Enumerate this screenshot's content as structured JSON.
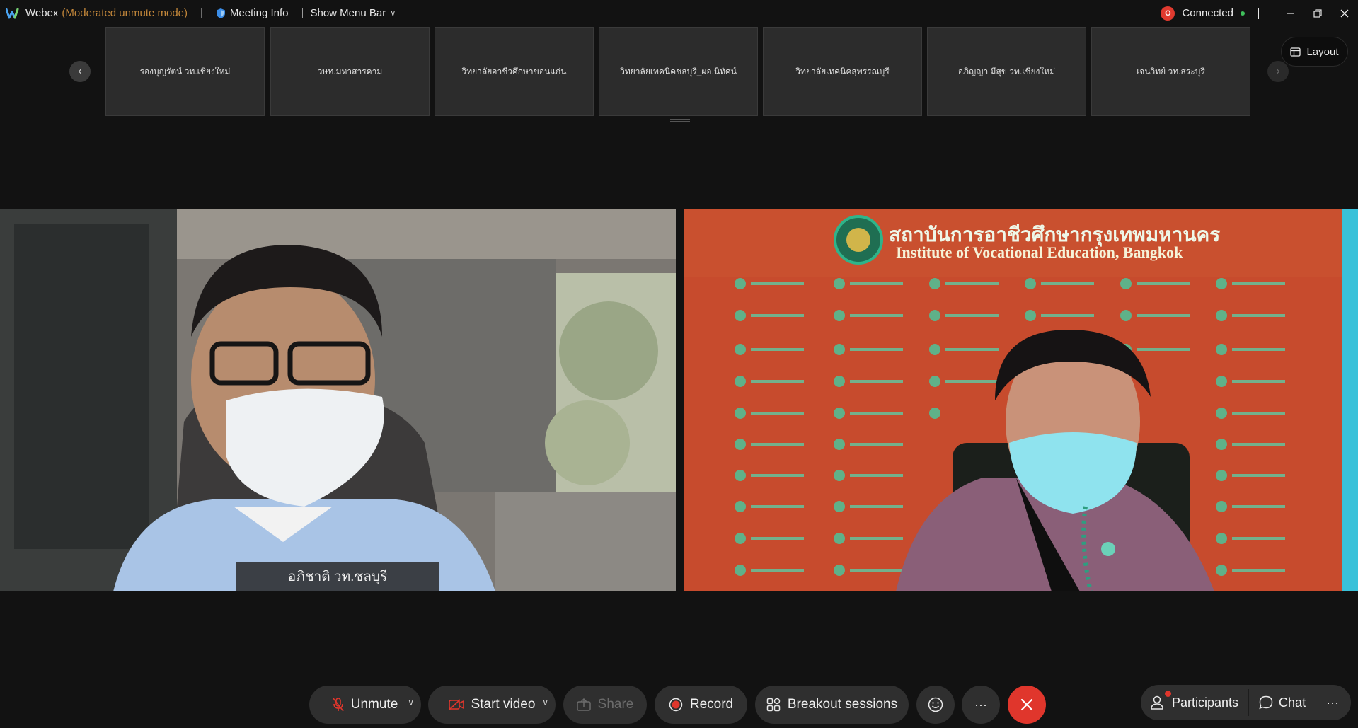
{
  "titlebar": {
    "app_name": "Webex",
    "mode": "(Moderated unmute mode)",
    "separator": "|",
    "meeting_info": "Meeting Info",
    "show_menu_bar": "Show Menu Bar",
    "record_badge": "O",
    "connection_status": "Connected"
  },
  "filmstrip": {
    "participants": [
      "รองบุญรัตน์ วท.เชียงใหม่",
      "วษท.มหาสารคาม",
      "วิทยาลัยอาชีวศึกษาขอนแก่น",
      "วิทยาลัยเทคนิคชลบุรี_ผอ.นิทัศน์",
      "วิทยาลัยเทคนิคสุพรรณบุรี",
      "อภิญญา มีสุข วท.เชียงใหม่",
      "เจนวิทย์ วท.สระบุรี"
    ],
    "layout_label": "Layout"
  },
  "videos": {
    "left_name": "อภิชาติ วท.ชลบุรี",
    "right_banner_th": "สถาบันการอาชีวศึกษากรุงเทพมหานคร",
    "right_banner_en": "Institute of Vocational Education, Bangkok"
  },
  "toolbar": {
    "unmute": "Unmute",
    "start_video": "Start video",
    "share": "Share",
    "record": "Record",
    "breakout": "Breakout sessions",
    "more": "···",
    "participants": "Participants",
    "chat": "Chat",
    "right_more": "···"
  },
  "colors": {
    "accent_mode": "#c3873a",
    "end_call": "#e0362c",
    "connected": "#3fbf5b",
    "background": "#121212"
  }
}
